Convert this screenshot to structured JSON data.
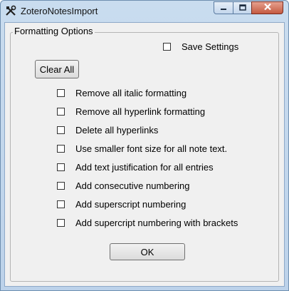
{
  "window": {
    "title": "ZoteroNotesImport"
  },
  "group": {
    "label": "Formatting Options"
  },
  "save_settings": {
    "label": "Save Settings",
    "checked": false
  },
  "clear_all": {
    "label": "Clear All"
  },
  "options": [
    {
      "label": "Remove all italic formatting",
      "checked": false
    },
    {
      "label": "Remove all hyperlink formatting",
      "checked": false
    },
    {
      "label": "Delete all hyperlinks",
      "checked": false
    },
    {
      "label": "Use smaller font size for all note text.",
      "checked": false
    },
    {
      "label": "Add text justification for all entries",
      "checked": false
    },
    {
      "label": "Add consecutive numbering",
      "checked": false
    },
    {
      "label": "Add superscript numbering",
      "checked": false
    },
    {
      "label": "Add supercript numbering with brackets",
      "checked": false
    }
  ],
  "ok": {
    "label": "OK"
  },
  "icons": {
    "app": "tools-icon",
    "minimize": "minimize-icon",
    "maximize": "maximize-icon",
    "close": "close-icon"
  }
}
